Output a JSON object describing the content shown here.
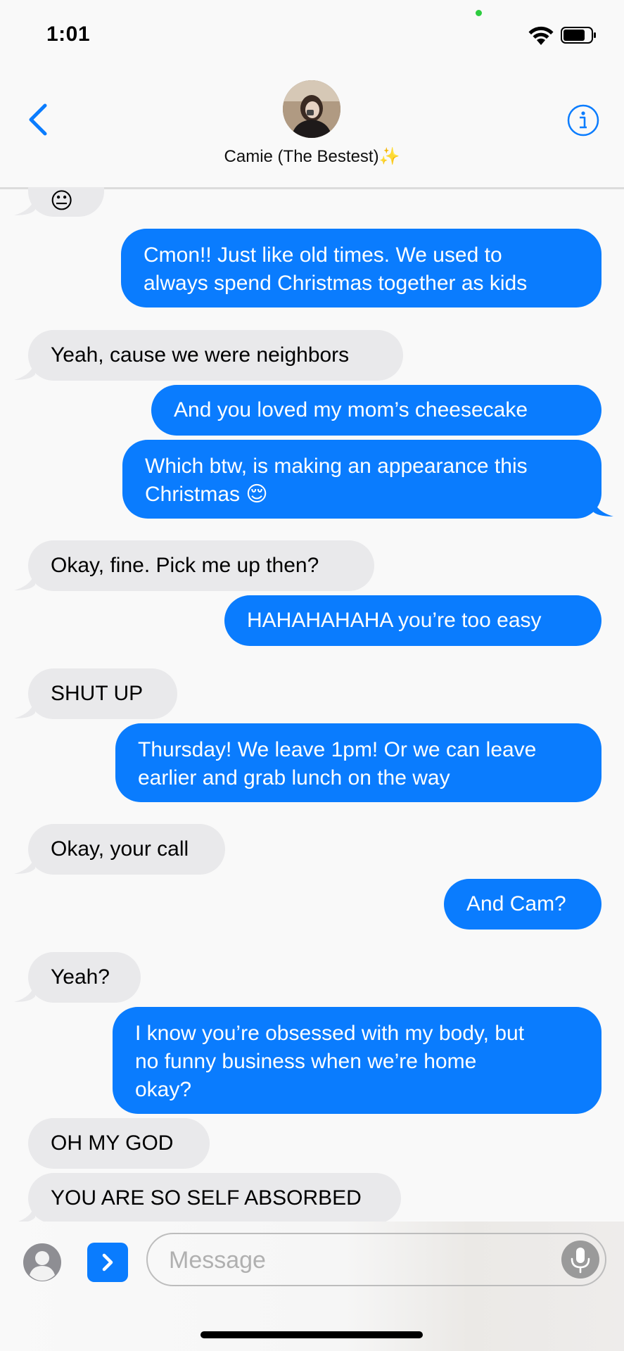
{
  "status_bar": {
    "time": "1:01"
  },
  "header": {
    "contact_name": "Camie (The Bestest)✨"
  },
  "messages": [
    {
      "from": "them",
      "text": "😐"
    },
    {
      "from": "me",
      "text": "Cmon!! Just like old times. We used to\nalways spend Christmas together as kids"
    },
    {
      "from": "them",
      "text": "Yeah, cause we were neighbors"
    },
    {
      "from": "me",
      "text": "And you loved my mom’s cheesecake"
    },
    {
      "from": "me",
      "text": "Which btw, is making an appearance this\nChristmas 😌"
    },
    {
      "from": "them",
      "text": "Okay, fine. Pick me up then?"
    },
    {
      "from": "me",
      "text": "HAHAHAHAHA you’re too easy"
    },
    {
      "from": "them",
      "text": "SHUT UP"
    },
    {
      "from": "me",
      "text": "Thursday! We leave 1pm! Or we can leave\nearlier and grab lunch on the way"
    },
    {
      "from": "them",
      "text": "Okay, your call"
    },
    {
      "from": "me",
      "text": "And Cam?"
    },
    {
      "from": "them",
      "text": "Yeah?"
    },
    {
      "from": "me",
      "text": "I know you’re obsessed with my body, but\nno funny business when we’re home\nokay?"
    },
    {
      "from": "them",
      "text": "OH MY GOD"
    },
    {
      "from": "them",
      "text": "YOU ARE SO SELF ABSORBED"
    }
  ],
  "input_bar": {
    "placeholder": "Message"
  },
  "colors": {
    "accent": "#0a7cfe",
    "incoming_bubble": "#e9e9eb",
    "outgoing_bubble": "#0a7cfe"
  },
  "icons": [
    "wifi-icon",
    "battery-icon",
    "back-chevron-icon",
    "info-icon",
    "contact-icon",
    "apps-chevron-icon",
    "microphone-icon"
  ]
}
